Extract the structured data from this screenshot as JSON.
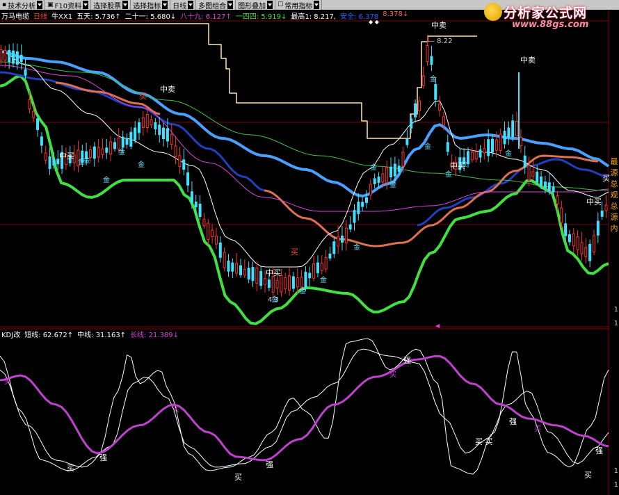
{
  "toolbar": {
    "items": [
      {
        "label": "技术分析",
        "icon": "menu-icon"
      },
      {
        "label": "F10资料",
        "icon": "doc-icon"
      },
      {
        "label": "选择股票",
        "icon": ""
      },
      {
        "label": "选择指标",
        "icon": ""
      },
      {
        "label": "日线",
        "icon": ""
      },
      {
        "label": "多图组合",
        "icon": ""
      },
      {
        "label": "图形叠加",
        "icon": ""
      },
      {
        "label": "常用指标",
        "icon": "settings-icon"
      }
    ]
  },
  "main_info": {
    "stock": "万马电缆",
    "period": "日线",
    "indicator": "牛XX1",
    "items": [
      {
        "label": "五天: 5.736↑",
        "color": "#ffffff"
      },
      {
        "label": "二十一: 5.680↓",
        "color": "#ffffff"
      },
      {
        "label": "八十九: 6.127↑",
        "color": "#e040e0"
      },
      {
        "label": "一四四: 5.919↓",
        "color": "#40e040"
      },
      {
        "label": "最高1: 8.217,",
        "color": "#ffffff"
      },
      {
        "label": "安全: 6.378",
        "color": "#3060ff"
      },
      {
        "label": "8.378↓",
        "color": "#ff6060"
      }
    ]
  },
  "sub_info": {
    "indicator": "KDJ改",
    "items": [
      {
        "label": "短线: 62.672↑",
        "color": "#ffffff"
      },
      {
        "label": "中线: 31.163↑",
        "color": "#ffffff"
      },
      {
        "label": "长线: 21.389↓",
        "color": "#e040e0"
      }
    ]
  },
  "main_labels": {
    "high_price": "8.22",
    "low_price": "4.3",
    "top_sell": "中卖",
    "sell": "中卖",
    "buy": "中买",
    "buy_small": "买",
    "gold": "金",
    "qiang": "强"
  },
  "right_axis": [
    "最",
    "源",
    "总",
    "观",
    "总",
    "源",
    "内"
  ],
  "bottom_marks": [
    "1",
    "1",
    "1",
    "1"
  ],
  "logo": {
    "name": "分析家公式网",
    "url": "www.88gs.com"
  },
  "colors": {
    "up": "#ff3030",
    "down": "#40e0ff",
    "ma5": "#ffffff",
    "ma89": "#e040e0",
    "ma144": "#40c040",
    "upper": "#40e040",
    "mid": "#4aa0ff",
    "stair": "#ffe8a0",
    "grid": "#800000"
  }
}
